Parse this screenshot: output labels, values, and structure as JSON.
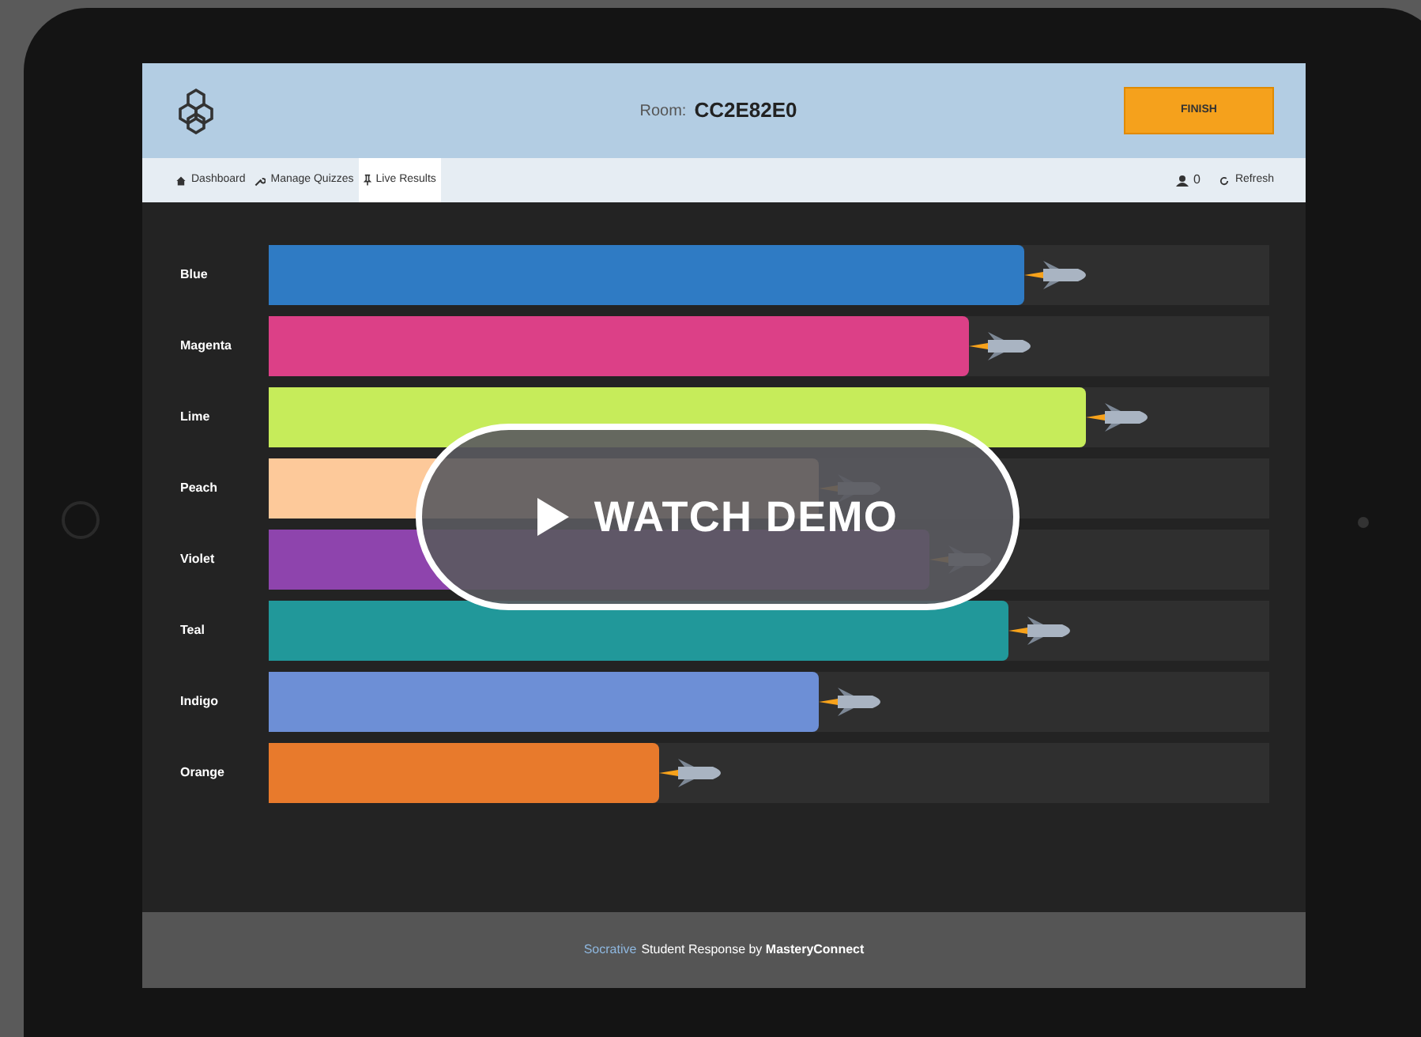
{
  "header": {
    "room_label": "Room:",
    "room_code": "CC2E82E0",
    "finish_button": "FINISH"
  },
  "nav": {
    "tabs": [
      {
        "label": "Dashboard",
        "selected": false
      },
      {
        "label": "Manage Quizzes",
        "selected": false
      },
      {
        "label": "Live Results",
        "selected": true
      }
    ],
    "student_count": "0",
    "refresh": "Refresh"
  },
  "race": [
    {
      "name": "Blue",
      "color": "#2f7bc4",
      "level": 0.755
    },
    {
      "name": "Magenta",
      "color": "#dc4087",
      "level": 0.7
    },
    {
      "name": "Lime",
      "color": "#c6ec5a",
      "level": 0.817
    },
    {
      "name": "Peach",
      "color": "#fdc99a",
      "level": 0.55
    },
    {
      "name": "Violet",
      "color": "#8e44ad",
      "level": 0.66
    },
    {
      "name": "Teal",
      "color": "#21989a",
      "level": 0.74
    },
    {
      "name": "Indigo",
      "color": "#6d8fd6",
      "level": 0.55
    },
    {
      "name": "Orange",
      "color": "#e87a2c",
      "level": 0.39
    }
  ],
  "overlay": {
    "label": "WATCH DEMO"
  },
  "footer": {
    "brand": "Socrative",
    "text": "Student Response by **MasteryConnect**"
  }
}
